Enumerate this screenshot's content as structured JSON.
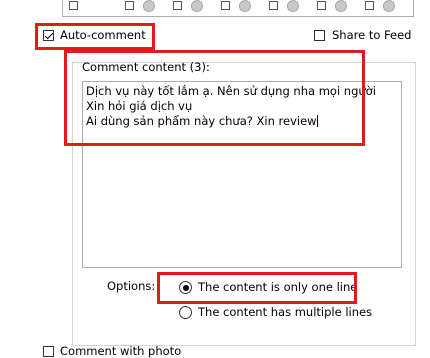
{
  "auto_comment": {
    "label": "Auto-comment",
    "checked": true
  },
  "share_to_feed": {
    "label": "Share to Feed",
    "checked": false
  },
  "comment_content": {
    "group_label": "Comment content (3):",
    "lines": [
      "Dịch vụ này tốt lắm ạ. Nên sử dụng nha mọi người",
      "Xin hỏi giá dịch vụ",
      "Ai dùng sản phẩm này chưa? Xin review"
    ]
  },
  "options": {
    "label": "Options:",
    "one_line": {
      "label": "The content is only one line",
      "selected": true
    },
    "multi_line": {
      "label": "The content has multiple lines",
      "selected": false
    }
  },
  "comment_with_photo": {
    "label": "Comment with photo",
    "checked": false
  },
  "colors": {
    "highlight": "#e01b1b"
  }
}
